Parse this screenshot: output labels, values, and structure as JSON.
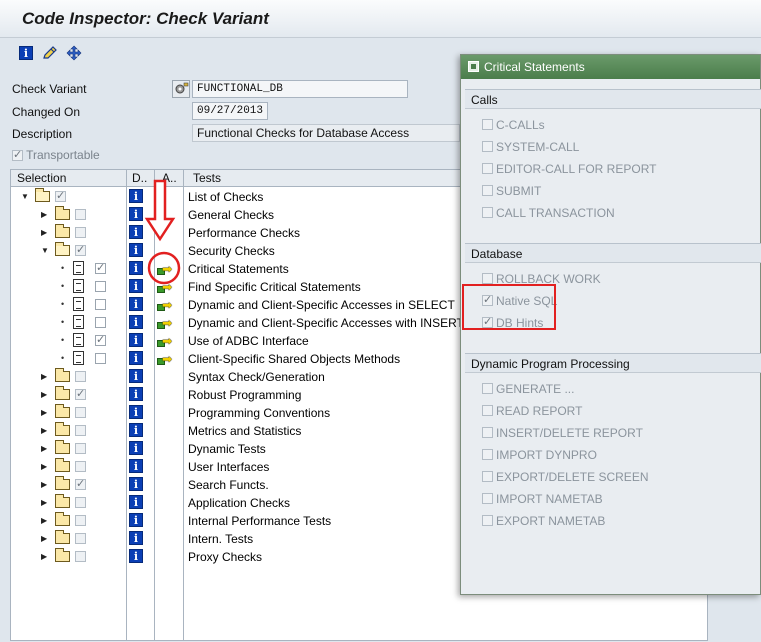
{
  "window": {
    "title": "Code Inspector: Check Variant"
  },
  "toolbar": {
    "icons": [
      "info-icon",
      "pencil-icon",
      "hierarchy-icon"
    ]
  },
  "header_fields": {
    "check_variant_label": "Check Variant",
    "check_variant_value": "FUNCTIONAL_DB",
    "changed_on_label": "Changed On",
    "changed_on_value": "09/27/2013",
    "description_label": "Description",
    "description_value": "Functional Checks for Database Access",
    "transportable_label": "Transportable"
  },
  "grid": {
    "headers": {
      "selection": "Selection",
      "doc": "D..",
      "attr": "A..",
      "tests": "Tests"
    },
    "rows": [
      {
        "label": "List of Checks",
        "level": 0,
        "kind": "folder-open",
        "expanded": true,
        "checked": true,
        "attr": false
      },
      {
        "label": "General Checks",
        "level": 1,
        "kind": "folder",
        "expanded": false,
        "checked": false,
        "attr": false
      },
      {
        "label": "Performance Checks",
        "level": 1,
        "kind": "folder",
        "expanded": false,
        "checked": false,
        "attr": false
      },
      {
        "label": "Security Checks",
        "level": 1,
        "kind": "folder-open",
        "expanded": true,
        "checked": true,
        "attr": false
      },
      {
        "label": "Critical Statements",
        "level": 2,
        "kind": "doc",
        "checked": true,
        "attr": true
      },
      {
        "label": "Find Specific Critical Statements",
        "level": 2,
        "kind": "doc",
        "checked": false,
        "attr": true
      },
      {
        "label": "Dynamic and Client-Specific Accesses in SELECT",
        "level": 2,
        "kind": "doc",
        "checked": false,
        "attr": true
      },
      {
        "label": "Dynamic and Client-Specific Accesses with INSERT",
        "level": 2,
        "kind": "doc",
        "checked": false,
        "attr": true
      },
      {
        "label": "Use of ADBC Interface",
        "level": 2,
        "kind": "doc",
        "checked": true,
        "attr": true
      },
      {
        "label": "Client-Specific Shared Objects Methods",
        "level": 2,
        "kind": "doc",
        "checked": false,
        "attr": true
      },
      {
        "label": "Syntax Check/Generation",
        "level": 1,
        "kind": "folder",
        "expanded": false,
        "checked": false,
        "attr": false
      },
      {
        "label": "Robust Programming",
        "level": 1,
        "kind": "folder",
        "expanded": false,
        "checked": true,
        "attr": false
      },
      {
        "label": "Programming Conventions",
        "level": 1,
        "kind": "folder",
        "expanded": false,
        "checked": false,
        "attr": false
      },
      {
        "label": "Metrics and Statistics",
        "level": 1,
        "kind": "folder",
        "expanded": false,
        "checked": false,
        "attr": false
      },
      {
        "label": "Dynamic Tests",
        "level": 1,
        "kind": "folder",
        "expanded": false,
        "checked": false,
        "attr": false
      },
      {
        "label": "User Interfaces",
        "level": 1,
        "kind": "folder",
        "expanded": false,
        "checked": false,
        "attr": false
      },
      {
        "label": "Search Functs.",
        "level": 1,
        "kind": "folder",
        "expanded": false,
        "checked": true,
        "attr": false
      },
      {
        "label": "Application Checks",
        "level": 1,
        "kind": "folder",
        "expanded": false,
        "checked": false,
        "attr": false
      },
      {
        "label": "Internal Performance Tests",
        "level": 1,
        "kind": "folder",
        "expanded": false,
        "checked": false,
        "attr": false
      },
      {
        "label": "Intern. Tests",
        "level": 1,
        "kind": "folder",
        "expanded": false,
        "checked": false,
        "attr": false
      },
      {
        "label": "Proxy Checks",
        "level": 1,
        "kind": "folder",
        "expanded": false,
        "checked": false,
        "attr": false
      }
    ]
  },
  "popup": {
    "title": "Critical Statements",
    "groups": [
      {
        "title": "Calls",
        "options": [
          {
            "label": "C-CALLs",
            "checked": false
          },
          {
            "label": "SYSTEM-CALL",
            "checked": false
          },
          {
            "label": "EDITOR-CALL FOR REPORT",
            "checked": false
          },
          {
            "label": "SUBMIT",
            "checked": false
          },
          {
            "label": "CALL TRANSACTION",
            "checked": false
          }
        ]
      },
      {
        "title": "Database",
        "options": [
          {
            "label": "ROLLBACK WORK",
            "checked": false
          },
          {
            "label": "Native SQL",
            "checked": true
          },
          {
            "label": "DB Hints",
            "checked": true
          }
        ]
      },
      {
        "title": "Dynamic Program Processing",
        "options": [
          {
            "label": "GENERATE ...",
            "checked": false
          },
          {
            "label": "READ REPORT",
            "checked": false
          },
          {
            "label": "INSERT/DELETE REPORT",
            "checked": false
          },
          {
            "label": "IMPORT DYNPRO",
            "checked": false
          },
          {
            "label": "EXPORT/DELETE SCREEN",
            "checked": false
          },
          {
            "label": "IMPORT NAMETAB",
            "checked": false
          },
          {
            "label": "EXPORT NAMETAB",
            "checked": false
          }
        ]
      }
    ]
  },
  "annotation_colors": {
    "highlight": "#e22020"
  }
}
